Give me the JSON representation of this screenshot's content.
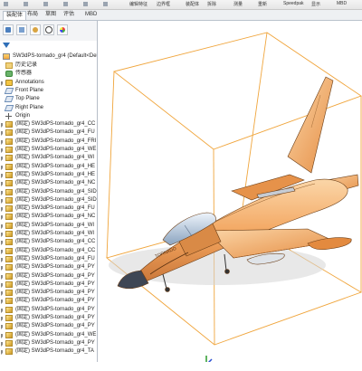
{
  "command_bar": {
    "labels": [
      "编辑特征",
      "边界框",
      "装配体",
      "拆除",
      "测量",
      "重新",
      "Speedpak",
      "显示",
      "MBD"
    ]
  },
  "tabs": [
    {
      "label": "装配体",
      "active": true
    },
    {
      "label": "布局",
      "active": false
    },
    {
      "label": "草图",
      "active": false
    },
    {
      "label": "评估",
      "active": false
    },
    {
      "label": "MBD",
      "active": false
    }
  ],
  "feature_manager": {
    "toolbar_icons": [
      "feature-tree-icon",
      "property-icon",
      "config-icon",
      "target-icon",
      "appearance-icon"
    ],
    "top_item": "SW3dPS-tornado_gr4 (Default<Del",
    "items": [
      {
        "label": "历史记录",
        "icon": "folder",
        "expand": false
      },
      {
        "label": "传感器",
        "icon": "sensor",
        "expand": false
      },
      {
        "label": "Annotations",
        "icon": "annot",
        "expand": true
      },
      {
        "label": "Front Plane",
        "icon": "plane",
        "expand": false
      },
      {
        "label": "Top Plane",
        "icon": "plane",
        "expand": false
      },
      {
        "label": "Right Plane",
        "icon": "plane",
        "expand": false
      },
      {
        "label": "Origin",
        "icon": "origin",
        "expand": false
      },
      {
        "label": "(固定) SW3dPS-tornado_gr4_CC",
        "icon": "asm",
        "expand": true
      },
      {
        "label": "(固定) SW3dPS-tornado_gr4_FU",
        "icon": "asm",
        "expand": true
      },
      {
        "label": "(固定) SW3dPS-tornado_gr4_FRI",
        "icon": "asm",
        "expand": true
      },
      {
        "label": "(固定) SW3dPS-tornado_gr4_WE",
        "icon": "asm",
        "expand": true
      },
      {
        "label": "(固定) SW3dPS-tornado_gr4_WI",
        "icon": "asm",
        "expand": true
      },
      {
        "label": "(固定) SW3dPS-tornado_gr4_HE",
        "icon": "asm",
        "expand": true
      },
      {
        "label": "(固定) SW3dPS-tornado_gr4_HE",
        "icon": "asm",
        "expand": true
      },
      {
        "label": "(固定) SW3dPS-tornado_gr4_NC",
        "icon": "asm",
        "expand": true
      },
      {
        "label": "(固定) SW3dPS-tornado_gr4_SID",
        "icon": "asm",
        "expand": true
      },
      {
        "label": "(固定) SW3dPS-tornado_gr4_SID",
        "icon": "asm",
        "expand": true
      },
      {
        "label": "(固定) SW3dPS-tornado_gr4_FU",
        "icon": "asm",
        "expand": true
      },
      {
        "label": "(固定) SW3dPS-tornado_gr4_NC",
        "icon": "asm",
        "expand": true
      },
      {
        "label": "(固定) SW3dPS-tornado_gr4_WI",
        "icon": "asm",
        "expand": true
      },
      {
        "label": "(固定) SW3dPS-tornado_gr4_WI",
        "icon": "asm",
        "expand": true
      },
      {
        "label": "(固定) SW3dPS-tornado_gr4_CC",
        "icon": "asm",
        "expand": true
      },
      {
        "label": "(固定) SW3dPS-tornado_gr4_CC",
        "icon": "asm",
        "expand": true
      },
      {
        "label": "(固定) SW3dPS-tornado_gr4_FU",
        "icon": "asm",
        "expand": true
      },
      {
        "label": "(固定) SW3dPS-tornado_gr4_PY",
        "icon": "asm",
        "expand": true
      },
      {
        "label": "(固定) SW3dPS-tornado_gr4_PY",
        "icon": "asm",
        "expand": true
      },
      {
        "label": "(固定) SW3dPS-tornado_gr4_PY",
        "icon": "asm",
        "expand": true
      },
      {
        "label": "(固定) SW3dPS-tornado_gr4_PY",
        "icon": "asm",
        "expand": true
      },
      {
        "label": "(固定) SW3dPS-tornado_gr4_PY",
        "icon": "asm",
        "expand": true
      },
      {
        "label": "(固定) SW3dPS-tornado_gr4_PY",
        "icon": "asm",
        "expand": true
      },
      {
        "label": "(固定) SW3dPS-tornado_gr4_PY",
        "icon": "asm",
        "expand": true
      },
      {
        "label": "(固定) SW3dPS-tornado_gr4_PY",
        "icon": "asm",
        "expand": true
      },
      {
        "label": "(固定) SW3dPS-tornado_gr4_WE",
        "icon": "asm",
        "expand": true
      },
      {
        "label": "(固定) SW3dPS-tornado_gr4_PY",
        "icon": "asm",
        "expand": true
      },
      {
        "label": "(固定) SW3dPS-tornado_gr4_TA",
        "icon": "asm",
        "expand": true
      }
    ]
  },
  "viewport": {
    "model_colors": {
      "body": "#f2a35c",
      "shade": "#c9773a",
      "light": "#fbd6a8",
      "bbox": "#f0a53c"
    },
    "logo_text": "TORNADO",
    "triad_icon": "coordinate-triad-icon"
  }
}
